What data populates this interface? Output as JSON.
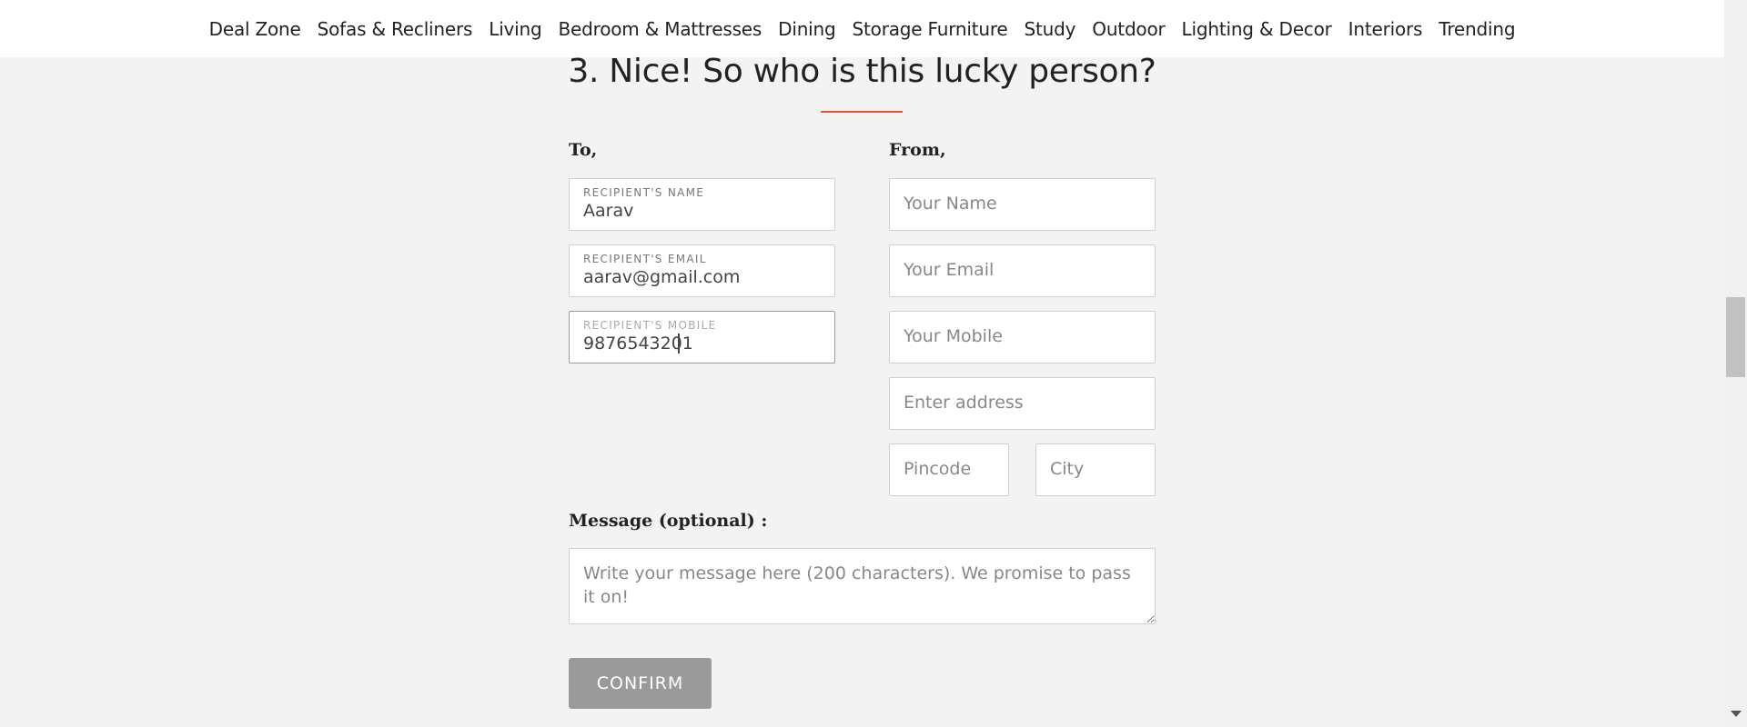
{
  "nav": {
    "items": [
      "Deal Zone",
      "Sofas & Recliners",
      "Living",
      "Bedroom & Mattresses",
      "Dining",
      "Storage Furniture",
      "Study",
      "Outdoor",
      "Lighting & Decor",
      "Interiors",
      "Trending"
    ]
  },
  "form": {
    "title": "3. Nice! So who is this lucky person?",
    "to_label": "To,",
    "from_label": "From,",
    "recipient_name": {
      "label": "RECIPIENT'S NAME",
      "value": "Aarav"
    },
    "recipient_email": {
      "label": "RECIPIENT'S EMAIL",
      "value": "aarav@gmail.com"
    },
    "recipient_mobile": {
      "label": "RECIPIENT'S MOBILE",
      "value": "9876543201"
    },
    "your_name": {
      "placeholder": "Your Name"
    },
    "your_email": {
      "placeholder": "Your Email"
    },
    "your_mobile": {
      "placeholder": "Your Mobile"
    },
    "address": {
      "placeholder": "Enter address"
    },
    "pincode": {
      "placeholder": "Pincode"
    },
    "city": {
      "placeholder": "City"
    },
    "message_label": "Message (optional) :",
    "message": {
      "placeholder": "Write your message here (200 characters). We promise to pass it on!"
    },
    "confirm_label": "CONFIRM"
  },
  "colors": {
    "accent": "#e8552a",
    "button_disabled": "#9a9a9a"
  }
}
